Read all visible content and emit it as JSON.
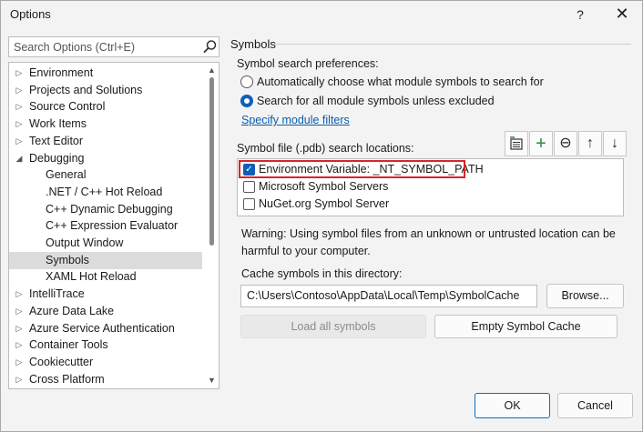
{
  "window": {
    "title": "Options",
    "help_label": "?",
    "close_label": "✕"
  },
  "search": {
    "placeholder": "Search Options (Ctrl+E)",
    "value": "",
    "icon": "search-icon"
  },
  "tree": {
    "items": [
      {
        "label": "Environment",
        "level": 0,
        "arrow": "▷"
      },
      {
        "label": "Projects and Solutions",
        "level": 0,
        "arrow": "▷"
      },
      {
        "label": "Source Control",
        "level": 0,
        "arrow": "▷"
      },
      {
        "label": "Work Items",
        "level": 0,
        "arrow": "▷"
      },
      {
        "label": "Text Editor",
        "level": 0,
        "arrow": "▷"
      },
      {
        "label": "Debugging",
        "level": 0,
        "arrow": "◢"
      },
      {
        "label": "General",
        "level": 1,
        "arrow": ""
      },
      {
        "label": ".NET / C++ Hot Reload",
        "level": 1,
        "arrow": ""
      },
      {
        "label": "C++ Dynamic Debugging",
        "level": 1,
        "arrow": ""
      },
      {
        "label": "C++ Expression Evaluator",
        "level": 1,
        "arrow": ""
      },
      {
        "label": "Output Window",
        "level": 1,
        "arrow": ""
      },
      {
        "label": "Symbols",
        "level": 1,
        "arrow": "",
        "selected": true
      },
      {
        "label": "XAML Hot Reload",
        "level": 1,
        "arrow": ""
      },
      {
        "label": "IntelliTrace",
        "level": 0,
        "arrow": "▷"
      },
      {
        "label": "Azure Data Lake",
        "level": 0,
        "arrow": "▷"
      },
      {
        "label": "Azure Service Authentication",
        "level": 0,
        "arrow": "▷"
      },
      {
        "label": "Container Tools",
        "level": 0,
        "arrow": "▷"
      },
      {
        "label": "Cookiecutter",
        "level": 0,
        "arrow": "▷"
      },
      {
        "label": "Cross Platform",
        "level": 0,
        "arrow": "▷"
      }
    ],
    "scroll_up": "▲",
    "scroll_down": "▼"
  },
  "symbols": {
    "section_title": "Symbols",
    "search_prefs_label": "Symbol search preferences:",
    "radio_auto": "Automatically choose what module symbols to search for",
    "radio_all": "Search for all module symbols unless excluded",
    "selected_radio": "all",
    "module_filters_link": "Specify module filters",
    "locations_label": "Symbol file (.pdb) search locations:",
    "toolbar": {
      "add_folder": "▤",
      "add": "+",
      "remove": "⊖",
      "up": "↑",
      "down": "↓"
    },
    "locations": [
      {
        "label": "Environment Variable: _NT_SYMBOL_PATH",
        "checked": true
      },
      {
        "label": "Microsoft Symbol Servers",
        "checked": false
      },
      {
        "label": "NuGet.org Symbol Server",
        "checked": false
      }
    ],
    "warning_line1": "Warning: Using symbol files from an unknown or untrusted location can be",
    "warning_line2": "harmful to your computer.",
    "cache_label": "Cache symbols in this directory:",
    "cache_path": "C:\\Users\\Contoso\\AppData\\Local\\Temp\\SymbolCache",
    "browse_label": "Browse...",
    "load_all_label": "Load all symbols",
    "empty_cache_label": "Empty Symbol Cache"
  },
  "footer": {
    "ok_label": "OK",
    "cancel_label": "Cancel"
  },
  "colors": {
    "accent": "#0f5fb8",
    "highlight": "#d9252a",
    "link": "#0b5cad",
    "selected_row": "#dcdcdc"
  }
}
